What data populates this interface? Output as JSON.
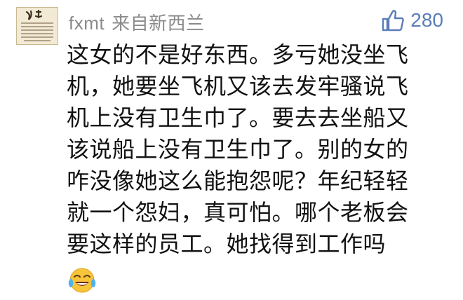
{
  "comment": {
    "username": "fxmt",
    "origin": "来自新西兰",
    "likes": "280",
    "lines": [
      "这女的不是好东西。多亏她没坐飞",
      "机，她要坐飞机又该去发牢骚说飞",
      "机上没有卫生巾了。要去去坐船又",
      "该说船上没有卫生巾了。别的女的",
      "咋没像她这么能抱怨呢？年纪轻轻",
      "就一个怨妇，真可怕。哪个老板会",
      "要这样的员工。她找得到工作吗"
    ],
    "emoji": "laughing-with-tears"
  },
  "colors": {
    "meta_text": "#8a8a8a",
    "like_blue": "#5b7db8",
    "body_text": "#111111",
    "avatar_bg": "#f3ead5"
  },
  "icons": {
    "like": "thumbs-up-icon",
    "emoji": "tears-of-joy-emoji"
  }
}
